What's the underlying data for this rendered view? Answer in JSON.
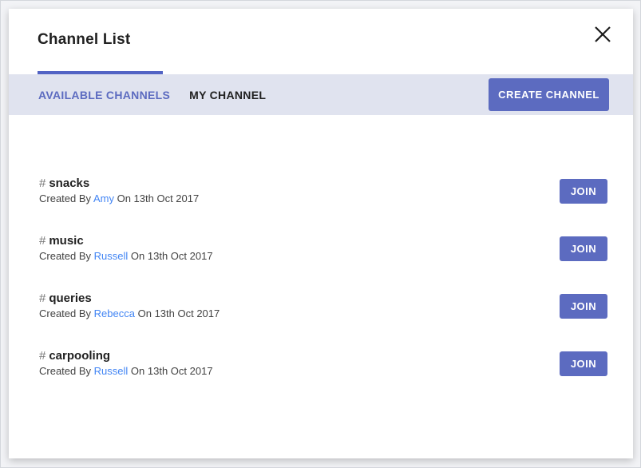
{
  "window": {
    "title": "Channel List"
  },
  "icons": {
    "close": "close-x",
    "hash": "#"
  },
  "tabs": {
    "available": "AVAILABLE CHANNELS",
    "my": "MY CHANNEL",
    "active_tab": "AVAILABLE CHANNELS"
  },
  "buttons": {
    "create": "CREATE CHANNEL"
  },
  "labels": {
    "created_by": "Created By",
    "on": "On",
    "join": "JOIN"
  },
  "channels": [
    {
      "name": "snacks",
      "creator": "Amy",
      "date": "13th Oct 2017"
    },
    {
      "name": "music",
      "creator": "Russell",
      "date": "13th Oct 2017"
    },
    {
      "name": "queries",
      "creator": "Rebecca",
      "date": "13th Oct 2017"
    },
    {
      "name": "carpooling",
      "creator": "Russell",
      "date": "13th Oct 2017"
    }
  ],
  "colors": {
    "accent": "#5c6bc0",
    "tab_indicator": "#5263c4",
    "tab_bar_bg": "#e0e3ef",
    "creator_link": "#4285f4",
    "title_text": "#212121"
  }
}
